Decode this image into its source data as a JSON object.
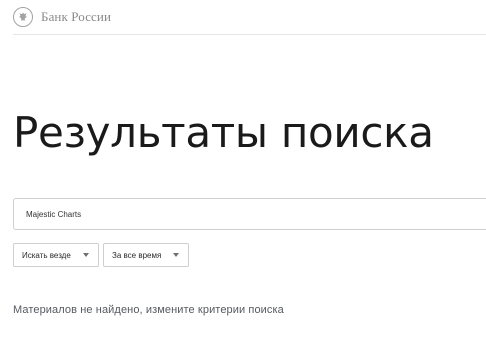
{
  "header": {
    "logo_icon": "eagle-emblem-icon",
    "logo_text": "Банк России"
  },
  "page": {
    "title": "Результаты поиска"
  },
  "search": {
    "value": "Majestic Charts"
  },
  "filters": [
    {
      "label": "Искать везде",
      "icon": "chevron-down-icon"
    },
    {
      "label": "За все время",
      "icon": "chevron-down-icon"
    }
  ],
  "results": {
    "message": "Материалов не найдено, измените критерии поиска"
  },
  "colors": {
    "border": "#cfcfcf",
    "header_divider": "#e6e6e6",
    "logo_gray": "#8a8a8a",
    "message_gray": "#555a60",
    "title": "#1a1a1a"
  }
}
